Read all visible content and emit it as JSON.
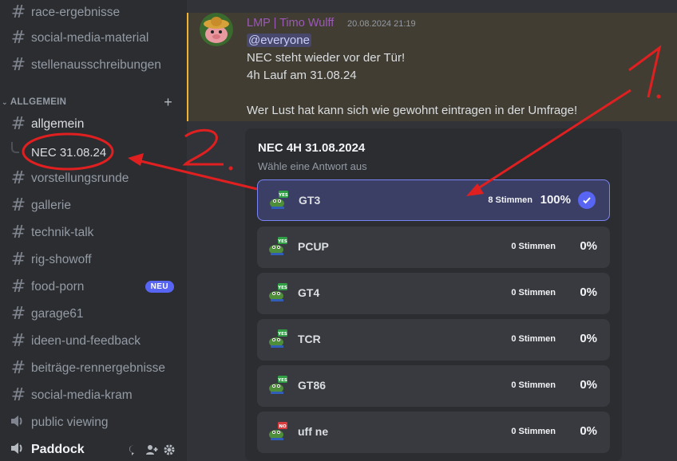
{
  "sidebar": {
    "channels_top": [
      {
        "name": "race-ergebnisse"
      },
      {
        "name": "social-media-material"
      },
      {
        "name": "stellenausschreibungen"
      }
    ],
    "category": {
      "label": "ALLGEMEIN"
    },
    "channels": [
      {
        "name": "allgemein"
      },
      {
        "name": "vorstellungsrunde"
      },
      {
        "name": "gallerie"
      },
      {
        "name": "technik-talk"
      },
      {
        "name": "rig-showoff"
      },
      {
        "name": "food-porn",
        "badge": "NEU"
      },
      {
        "name": "garage61"
      },
      {
        "name": "ideen-und-feedback"
      },
      {
        "name": "beiträge-rennergebnisse"
      },
      {
        "name": "social-media-kram"
      },
      {
        "name": "public viewing"
      }
    ],
    "thread": {
      "name": "NEC 31.08.24"
    },
    "voice_channel": {
      "name": "Paddock"
    }
  },
  "message": {
    "author": "LMP | Timo Wulff",
    "timestamp": "20.08.2024 21:19",
    "mention": "@everyone",
    "lines": [
      "NEC steht wieder vor der Tür!",
      "4h Lauf am 31.08.24",
      "Wer Lust hat kann sich wie gewohnt eintragen in der Umfrage!"
    ]
  },
  "poll": {
    "question": "NEC 4H 31.08.2024",
    "subtitle": "Wähle eine Antwort aus",
    "options": [
      {
        "label": "GT3",
        "votes": "8 Stimmen",
        "pct": "100%",
        "fraction": 1.0,
        "selected": true,
        "emoji": "pepe-yes-icon"
      },
      {
        "label": "PCUP",
        "votes": "0 Stimmen",
        "pct": "0%",
        "fraction": 0,
        "emoji": "pepe-yes-icon"
      },
      {
        "label": "GT4",
        "votes": "0 Stimmen",
        "pct": "0%",
        "fraction": 0,
        "emoji": "pepe-yes-icon"
      },
      {
        "label": "TCR",
        "votes": "0 Stimmen",
        "pct": "0%",
        "fraction": 0,
        "emoji": "pepe-yes-icon"
      },
      {
        "label": "GT86",
        "votes": "0 Stimmen",
        "pct": "0%",
        "fraction": 0,
        "emoji": "pepe-yes-icon"
      },
      {
        "label": "uff ne",
        "votes": "0 Stimmen",
        "pct": "0%",
        "fraction": 0,
        "emoji": "pepe-no-icon"
      }
    ]
  },
  "annotations": {
    "label_1": "1.",
    "label_2": "2.",
    "color": "#e02020"
  },
  "colors": {
    "author": "#9b59b6",
    "highlight_bar": "#f0b232",
    "accent": "#5865f2"
  }
}
